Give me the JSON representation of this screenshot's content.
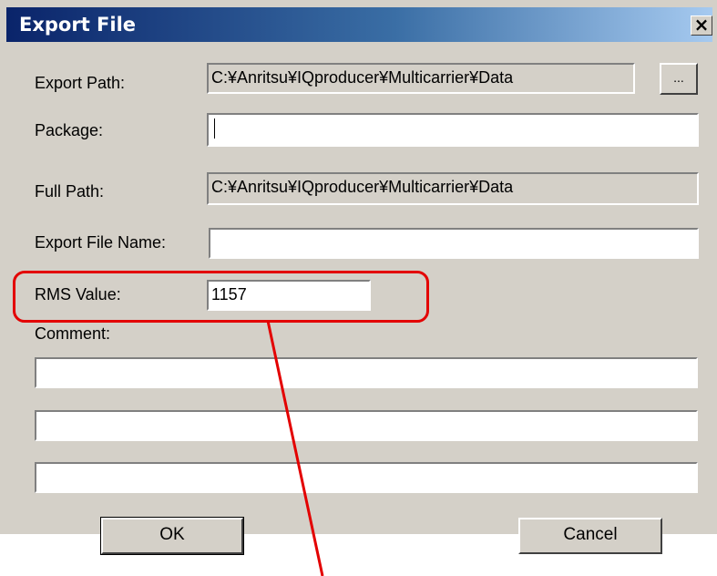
{
  "window": {
    "title": "Export File",
    "close_label": "×"
  },
  "fields": {
    "export_path": {
      "label": "Export Path:",
      "value": "C:¥Anritsu¥IQproducer¥Multicarrier¥Data"
    },
    "browse_button": "...",
    "package": {
      "label": "Package:",
      "value": ""
    },
    "full_path": {
      "label": "Full Path:",
      "value": "C:¥Anritsu¥IQproducer¥Multicarrier¥Data"
    },
    "export_file_name": {
      "label": "Export File Name:",
      "value": ""
    },
    "rms_value": {
      "label": "RMS Value:",
      "value": "1157"
    },
    "comment": {
      "label": "Comment:",
      "lines": [
        "",
        "",
        ""
      ]
    }
  },
  "buttons": {
    "ok": "OK",
    "cancel": "Cancel"
  },
  "annotation": {
    "color": "#e30000"
  }
}
